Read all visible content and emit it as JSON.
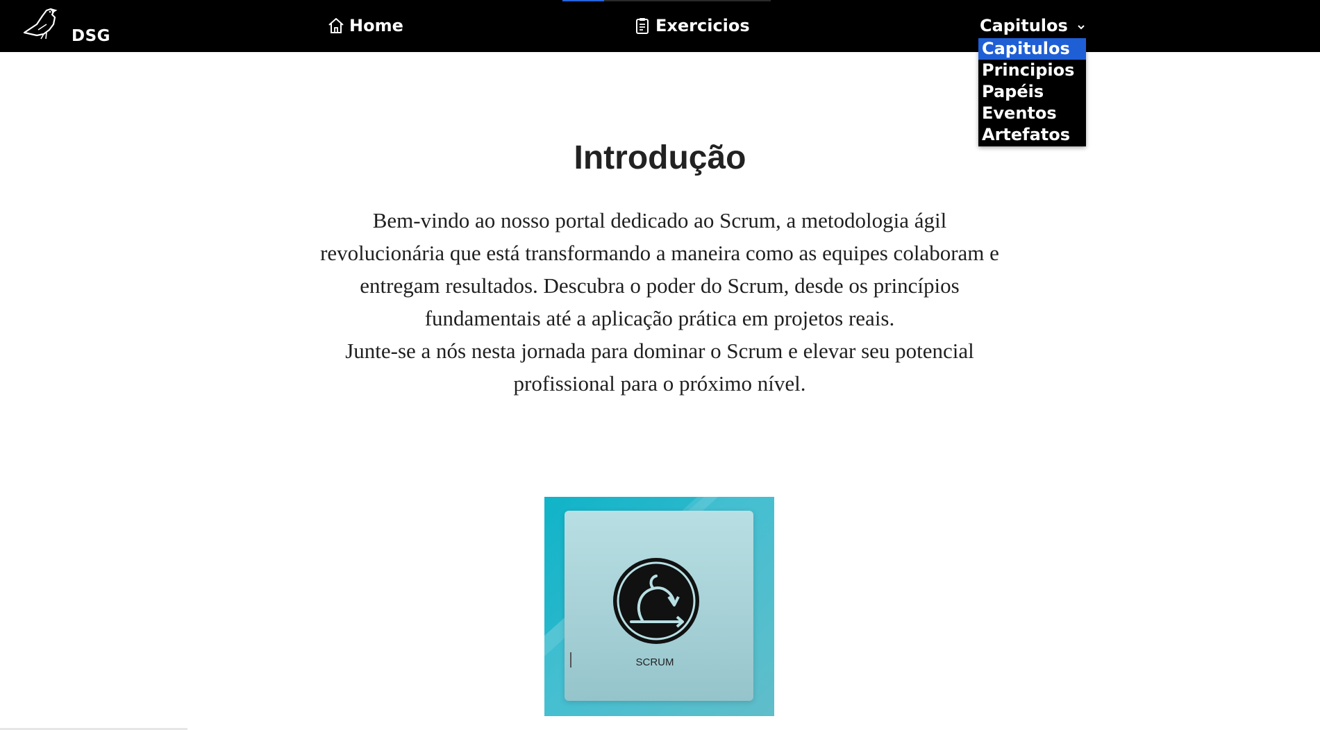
{
  "navbar": {
    "logo_text": "DSG",
    "home_label": "Home",
    "exercicios_label": "Exercicios",
    "capitulos_label": "Capitulos"
  },
  "dropdown": {
    "items": [
      {
        "label": "Capitulos",
        "active": true
      },
      {
        "label": "Principios",
        "active": false
      },
      {
        "label": "Papéis",
        "active": false
      },
      {
        "label": "Eventos",
        "active": false
      },
      {
        "label": "Artefatos",
        "active": false
      }
    ],
    "active_color": "#1f5fd6"
  },
  "main": {
    "title": "Introdução",
    "paragraph1": "Bem-vindo ao nosso portal dedicado ao Scrum, a metodologia ágil revolucionária que está transformando a maneira como as equipes colaboram e entregam resultados. Descubra o poder do Scrum, desde os princípios fundamentais até a aplicação prática em projetos reais.",
    "paragraph2": "Junte-se a nós nesta jornada para dominar o Scrum e elevar seu potencial profissional para o próximo nível.",
    "image_label": "SCRUM"
  },
  "colors": {
    "navbar_bg": "#000000",
    "accent": "#1f5fd6",
    "image_bg": "#2fb8cc"
  }
}
